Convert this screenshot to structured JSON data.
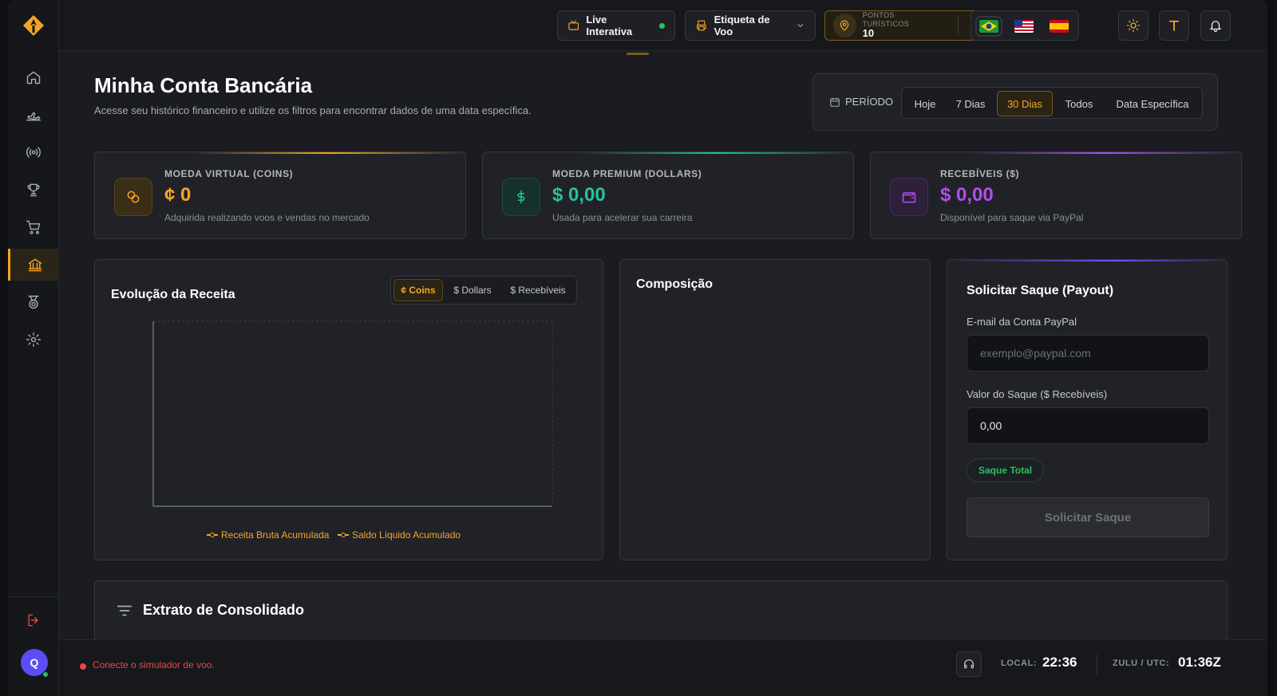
{
  "topbar": {
    "live_label": "Live Interativa",
    "flight_label": "Etiqueta de Voo",
    "points_label": "PONTOS TURÍSTICOS",
    "points_value": "10",
    "languages": [
      "pt-BR",
      "en-US",
      "es-ES"
    ]
  },
  "sidebar": {
    "items": [
      "home-icon",
      "plane-icon",
      "broadcast-icon",
      "trophy-icon",
      "cart-icon",
      "bank-icon",
      "medal-icon",
      "gear-icon"
    ],
    "active_item": "bank-icon",
    "avatar_initial": "Q"
  },
  "page": {
    "title": "Minha Conta Bancária",
    "subtitle": "Acesse seu histórico financeiro e utilize os filtros para encontrar dados de uma data específica."
  },
  "period": {
    "label": "PERÍODO",
    "options": [
      "Hoje",
      "7 Dias",
      "30 Dias",
      "Todos",
      "Data Específica"
    ],
    "selected": "30 Dias"
  },
  "stats": [
    {
      "label": "MOEDA VIRTUAL (COINS)",
      "value": "¢ 0",
      "sub": "Adquirida realizando voos e vendas no mercado",
      "color": "#f5a524"
    },
    {
      "label": "MOEDA PREMIUM (DOLLARS)",
      "value": "$ 0,00",
      "sub": "Usada para acelerar sua carreira",
      "color": "#22c59a"
    },
    {
      "label": "RECEBÍVEIS ($)",
      "value": "$ 0,00",
      "sub": "Disponível para saque via PayPal",
      "color": "#b44cf0"
    }
  ],
  "revenue": {
    "title": "Evolução da Receita",
    "tabs": [
      "¢ Coins",
      "$ Dollars",
      "$ Recebíveis"
    ],
    "active_tab": "¢ Coins",
    "legend": [
      "Receita Bruta Acumulada",
      "Saldo Líquido Acumulado"
    ]
  },
  "composition": {
    "title": "Composição"
  },
  "payout": {
    "title": "Solicitar Saque (Payout)",
    "email_label": "E-mail da Conta PayPal",
    "email_placeholder": "exemplo@paypal.com",
    "amount_label": "Valor do Saque ($ Recebíveis)",
    "amount_value": "0,00",
    "total_chip": "Saque Total",
    "submit_label": "Solicitar Saque"
  },
  "extrato": {
    "title": "Extrato de Consolidado"
  },
  "statusbar": {
    "message": "Conecte o simulador de voo.",
    "local_label": "LOCAL:",
    "local_time": "22:36",
    "zulu_label": "ZULU / UTC:",
    "zulu_time": "01:36Z"
  },
  "colors": {
    "accent": "#f5a524",
    "success": "#22c55e",
    "error": "#ef4444"
  }
}
